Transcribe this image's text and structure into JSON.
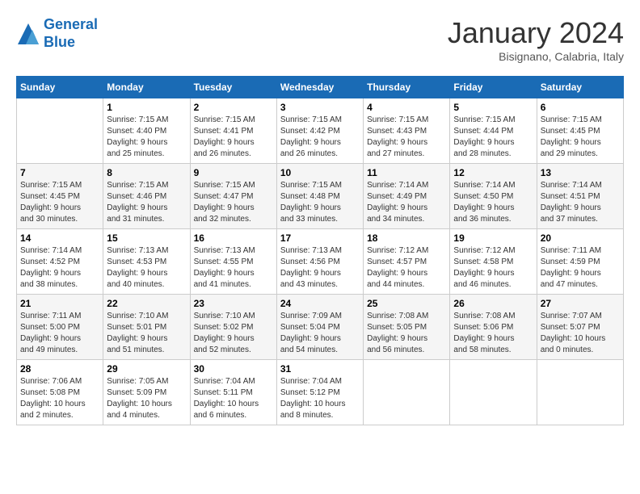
{
  "logo": {
    "line1": "General",
    "line2": "Blue"
  },
  "title": "January 2024",
  "subtitle": "Bisignano, Calabria, Italy",
  "days_of_week": [
    "Sunday",
    "Monday",
    "Tuesday",
    "Wednesday",
    "Thursday",
    "Friday",
    "Saturday"
  ],
  "weeks": [
    [
      {
        "day": "",
        "info": ""
      },
      {
        "day": "1",
        "info": "Sunrise: 7:15 AM\nSunset: 4:40 PM\nDaylight: 9 hours\nand 25 minutes."
      },
      {
        "day": "2",
        "info": "Sunrise: 7:15 AM\nSunset: 4:41 PM\nDaylight: 9 hours\nand 26 minutes."
      },
      {
        "day": "3",
        "info": "Sunrise: 7:15 AM\nSunset: 4:42 PM\nDaylight: 9 hours\nand 26 minutes."
      },
      {
        "day": "4",
        "info": "Sunrise: 7:15 AM\nSunset: 4:43 PM\nDaylight: 9 hours\nand 27 minutes."
      },
      {
        "day": "5",
        "info": "Sunrise: 7:15 AM\nSunset: 4:44 PM\nDaylight: 9 hours\nand 28 minutes."
      },
      {
        "day": "6",
        "info": "Sunrise: 7:15 AM\nSunset: 4:45 PM\nDaylight: 9 hours\nand 29 minutes."
      }
    ],
    [
      {
        "day": "7",
        "info": "Sunrise: 7:15 AM\nSunset: 4:45 PM\nDaylight: 9 hours\nand 30 minutes."
      },
      {
        "day": "8",
        "info": "Sunrise: 7:15 AM\nSunset: 4:46 PM\nDaylight: 9 hours\nand 31 minutes."
      },
      {
        "day": "9",
        "info": "Sunrise: 7:15 AM\nSunset: 4:47 PM\nDaylight: 9 hours\nand 32 minutes."
      },
      {
        "day": "10",
        "info": "Sunrise: 7:15 AM\nSunset: 4:48 PM\nDaylight: 9 hours\nand 33 minutes."
      },
      {
        "day": "11",
        "info": "Sunrise: 7:14 AM\nSunset: 4:49 PM\nDaylight: 9 hours\nand 34 minutes."
      },
      {
        "day": "12",
        "info": "Sunrise: 7:14 AM\nSunset: 4:50 PM\nDaylight: 9 hours\nand 36 minutes."
      },
      {
        "day": "13",
        "info": "Sunrise: 7:14 AM\nSunset: 4:51 PM\nDaylight: 9 hours\nand 37 minutes."
      }
    ],
    [
      {
        "day": "14",
        "info": "Sunrise: 7:14 AM\nSunset: 4:52 PM\nDaylight: 9 hours\nand 38 minutes."
      },
      {
        "day": "15",
        "info": "Sunrise: 7:13 AM\nSunset: 4:53 PM\nDaylight: 9 hours\nand 40 minutes."
      },
      {
        "day": "16",
        "info": "Sunrise: 7:13 AM\nSunset: 4:55 PM\nDaylight: 9 hours\nand 41 minutes."
      },
      {
        "day": "17",
        "info": "Sunrise: 7:13 AM\nSunset: 4:56 PM\nDaylight: 9 hours\nand 43 minutes."
      },
      {
        "day": "18",
        "info": "Sunrise: 7:12 AM\nSunset: 4:57 PM\nDaylight: 9 hours\nand 44 minutes."
      },
      {
        "day": "19",
        "info": "Sunrise: 7:12 AM\nSunset: 4:58 PM\nDaylight: 9 hours\nand 46 minutes."
      },
      {
        "day": "20",
        "info": "Sunrise: 7:11 AM\nSunset: 4:59 PM\nDaylight: 9 hours\nand 47 minutes."
      }
    ],
    [
      {
        "day": "21",
        "info": "Sunrise: 7:11 AM\nSunset: 5:00 PM\nDaylight: 9 hours\nand 49 minutes."
      },
      {
        "day": "22",
        "info": "Sunrise: 7:10 AM\nSunset: 5:01 PM\nDaylight: 9 hours\nand 51 minutes."
      },
      {
        "day": "23",
        "info": "Sunrise: 7:10 AM\nSunset: 5:02 PM\nDaylight: 9 hours\nand 52 minutes."
      },
      {
        "day": "24",
        "info": "Sunrise: 7:09 AM\nSunset: 5:04 PM\nDaylight: 9 hours\nand 54 minutes."
      },
      {
        "day": "25",
        "info": "Sunrise: 7:08 AM\nSunset: 5:05 PM\nDaylight: 9 hours\nand 56 minutes."
      },
      {
        "day": "26",
        "info": "Sunrise: 7:08 AM\nSunset: 5:06 PM\nDaylight: 9 hours\nand 58 minutes."
      },
      {
        "day": "27",
        "info": "Sunrise: 7:07 AM\nSunset: 5:07 PM\nDaylight: 10 hours\nand 0 minutes."
      }
    ],
    [
      {
        "day": "28",
        "info": "Sunrise: 7:06 AM\nSunset: 5:08 PM\nDaylight: 10 hours\nand 2 minutes."
      },
      {
        "day": "29",
        "info": "Sunrise: 7:05 AM\nSunset: 5:09 PM\nDaylight: 10 hours\nand 4 minutes."
      },
      {
        "day": "30",
        "info": "Sunrise: 7:04 AM\nSunset: 5:11 PM\nDaylight: 10 hours\nand 6 minutes."
      },
      {
        "day": "31",
        "info": "Sunrise: 7:04 AM\nSunset: 5:12 PM\nDaylight: 10 hours\nand 8 minutes."
      },
      {
        "day": "",
        "info": ""
      },
      {
        "day": "",
        "info": ""
      },
      {
        "day": "",
        "info": ""
      }
    ]
  ]
}
